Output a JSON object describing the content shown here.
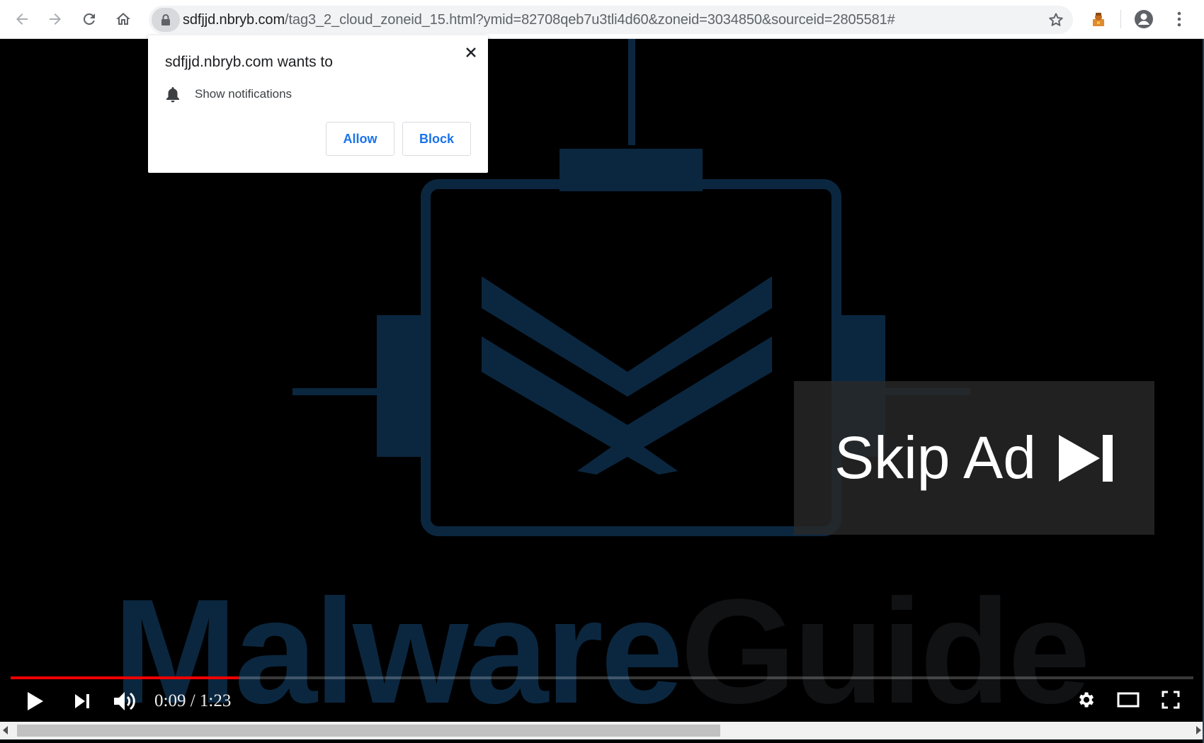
{
  "browser": {
    "url_host": "sdfjjd.nbryb.com",
    "url_path": "/tag3_2_cloud_zoneid_15.html?ymid=82708qeb7u3tli4d60&zoneid=3034850&sourceid=2805581#",
    "icons": [
      "back-arrow-icon",
      "forward-arrow-icon",
      "reload-icon",
      "home-icon",
      "lock-icon",
      "star-icon",
      "extension-icon",
      "account-icon",
      "more-vert-icon"
    ]
  },
  "prompt": {
    "title": "sdfjjd.nbryb.com wants to",
    "permission": "Show notifications",
    "allow": "Allow",
    "block": "Block"
  },
  "video": {
    "watermark_part1": "Malware",
    "watermark_part2": "Guide",
    "skip_label": "Skip Ad",
    "time": "0:09 / 1:23",
    "progress_fraction": 0.193
  },
  "colors": {
    "accent_blue": "#1a73e8",
    "progress_red": "#e00000",
    "logo_blue": "#0b2740"
  }
}
